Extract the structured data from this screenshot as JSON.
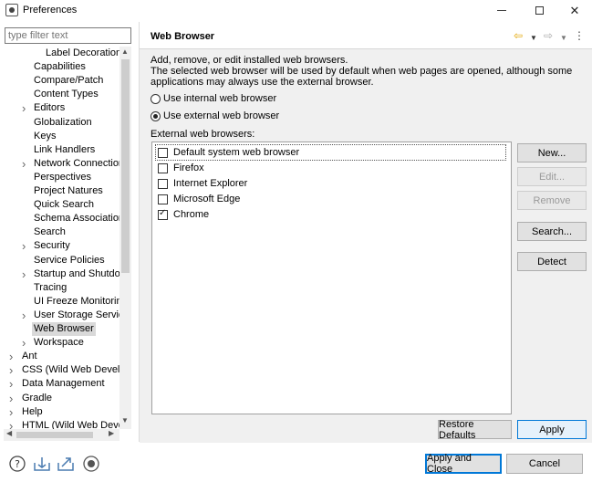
{
  "window": {
    "title": "Preferences"
  },
  "filter": {
    "placeholder": "type filter text"
  },
  "tree": [
    {
      "label": "Label Decorations",
      "level": 2,
      "arrow": false
    },
    {
      "label": "Capabilities",
      "level": 2,
      "arrow": false
    },
    {
      "label": "Compare/Patch",
      "level": 2,
      "arrow": false
    },
    {
      "label": "Content Types",
      "level": 2,
      "arrow": false
    },
    {
      "label": "Editors",
      "level": 2,
      "arrow": true
    },
    {
      "label": "Globalization",
      "level": 2,
      "arrow": false
    },
    {
      "label": "Keys",
      "level": 2,
      "arrow": false
    },
    {
      "label": "Link Handlers",
      "level": 2,
      "arrow": false
    },
    {
      "label": "Network Connection",
      "level": 2,
      "arrow": true
    },
    {
      "label": "Perspectives",
      "level": 2,
      "arrow": false
    },
    {
      "label": "Project Natures",
      "level": 2,
      "arrow": false
    },
    {
      "label": "Quick Search",
      "level": 2,
      "arrow": false
    },
    {
      "label": "Schema Associations",
      "level": 2,
      "arrow": false
    },
    {
      "label": "Search",
      "level": 2,
      "arrow": false
    },
    {
      "label": "Security",
      "level": 2,
      "arrow": true
    },
    {
      "label": "Service Policies",
      "level": 2,
      "arrow": false
    },
    {
      "label": "Startup and Shutdow",
      "level": 2,
      "arrow": true
    },
    {
      "label": "Tracing",
      "level": 2,
      "arrow": false
    },
    {
      "label": "UI Freeze Monitoring",
      "level": 2,
      "arrow": false
    },
    {
      "label": "User Storage Service",
      "level": 2,
      "arrow": true
    },
    {
      "label": "Web Browser",
      "level": 2,
      "arrow": false,
      "selected": true
    },
    {
      "label": "Workspace",
      "level": 2,
      "arrow": true
    },
    {
      "label": "Ant",
      "level": 1,
      "arrow": true
    },
    {
      "label": "CSS (Wild Web Develop",
      "level": 1,
      "arrow": true
    },
    {
      "label": "Data Management",
      "level": 1,
      "arrow": true
    },
    {
      "label": "Gradle",
      "level": 1,
      "arrow": true
    },
    {
      "label": "Help",
      "level": 1,
      "arrow": true
    },
    {
      "label": "HTML (Wild Web Develo",
      "level": 1,
      "arrow": true
    }
  ],
  "page": {
    "title": "Web Browser",
    "description_1": "Add, remove, or edit installed web browsers.",
    "description_2": "The selected web browser will be used by default when web pages are opened, although some applications may always use the external browser.",
    "radio_internal": "Use internal web browser",
    "radio_external": "Use external web browser",
    "selected_radio": "external",
    "external_label": "External web browsers:",
    "browsers": [
      {
        "name": "Default system web browser",
        "checked": false
      },
      {
        "name": "Firefox",
        "checked": false
      },
      {
        "name": "Internet Explorer",
        "checked": false
      },
      {
        "name": "Microsoft Edge",
        "checked": false
      },
      {
        "name": "Chrome",
        "checked": true
      }
    ],
    "buttons": {
      "new": "New...",
      "edit": "Edit...",
      "remove": "Remove",
      "search": "Search...",
      "detect": "Detect"
    },
    "restore_defaults": "Restore Defaults",
    "apply": "Apply"
  },
  "footer": {
    "apply_and_close": "Apply and Close",
    "cancel": "Cancel"
  },
  "colors": {
    "accent": "#0078d7",
    "nav_back": "#e2a500"
  }
}
